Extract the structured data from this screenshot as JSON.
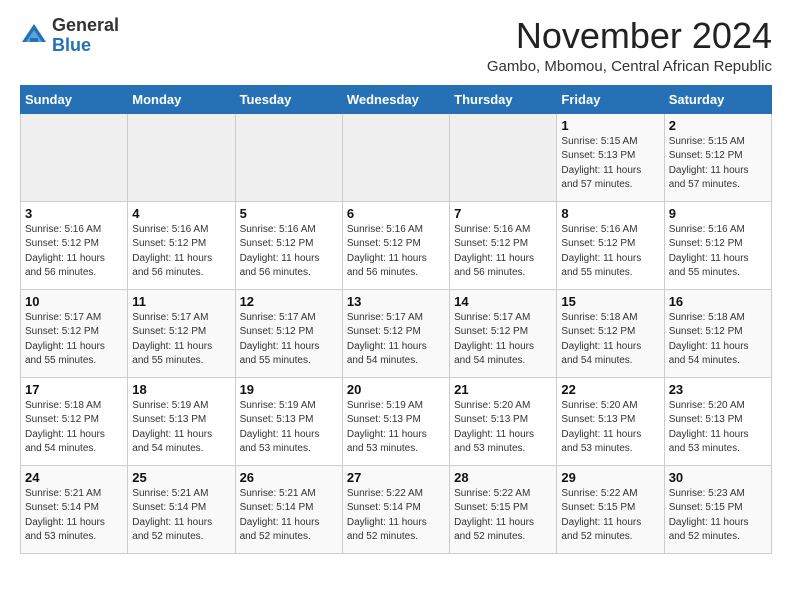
{
  "logo": {
    "general": "General",
    "blue": "Blue"
  },
  "header": {
    "month": "November 2024",
    "location": "Gambo, Mbomou, Central African Republic"
  },
  "weekdays": [
    "Sunday",
    "Monday",
    "Tuesday",
    "Wednesday",
    "Thursday",
    "Friday",
    "Saturday"
  ],
  "weeks": [
    [
      {
        "day": "",
        "info": ""
      },
      {
        "day": "",
        "info": ""
      },
      {
        "day": "",
        "info": ""
      },
      {
        "day": "",
        "info": ""
      },
      {
        "day": "",
        "info": ""
      },
      {
        "day": "1",
        "info": "Sunrise: 5:15 AM\nSunset: 5:13 PM\nDaylight: 11 hours\nand 57 minutes."
      },
      {
        "day": "2",
        "info": "Sunrise: 5:15 AM\nSunset: 5:12 PM\nDaylight: 11 hours\nand 57 minutes."
      }
    ],
    [
      {
        "day": "3",
        "info": "Sunrise: 5:16 AM\nSunset: 5:12 PM\nDaylight: 11 hours\nand 56 minutes."
      },
      {
        "day": "4",
        "info": "Sunrise: 5:16 AM\nSunset: 5:12 PM\nDaylight: 11 hours\nand 56 minutes."
      },
      {
        "day": "5",
        "info": "Sunrise: 5:16 AM\nSunset: 5:12 PM\nDaylight: 11 hours\nand 56 minutes."
      },
      {
        "day": "6",
        "info": "Sunrise: 5:16 AM\nSunset: 5:12 PM\nDaylight: 11 hours\nand 56 minutes."
      },
      {
        "day": "7",
        "info": "Sunrise: 5:16 AM\nSunset: 5:12 PM\nDaylight: 11 hours\nand 56 minutes."
      },
      {
        "day": "8",
        "info": "Sunrise: 5:16 AM\nSunset: 5:12 PM\nDaylight: 11 hours\nand 55 minutes."
      },
      {
        "day": "9",
        "info": "Sunrise: 5:16 AM\nSunset: 5:12 PM\nDaylight: 11 hours\nand 55 minutes."
      }
    ],
    [
      {
        "day": "10",
        "info": "Sunrise: 5:17 AM\nSunset: 5:12 PM\nDaylight: 11 hours\nand 55 minutes."
      },
      {
        "day": "11",
        "info": "Sunrise: 5:17 AM\nSunset: 5:12 PM\nDaylight: 11 hours\nand 55 minutes."
      },
      {
        "day": "12",
        "info": "Sunrise: 5:17 AM\nSunset: 5:12 PM\nDaylight: 11 hours\nand 55 minutes."
      },
      {
        "day": "13",
        "info": "Sunrise: 5:17 AM\nSunset: 5:12 PM\nDaylight: 11 hours\nand 54 minutes."
      },
      {
        "day": "14",
        "info": "Sunrise: 5:17 AM\nSunset: 5:12 PM\nDaylight: 11 hours\nand 54 minutes."
      },
      {
        "day": "15",
        "info": "Sunrise: 5:18 AM\nSunset: 5:12 PM\nDaylight: 11 hours\nand 54 minutes."
      },
      {
        "day": "16",
        "info": "Sunrise: 5:18 AM\nSunset: 5:12 PM\nDaylight: 11 hours\nand 54 minutes."
      }
    ],
    [
      {
        "day": "17",
        "info": "Sunrise: 5:18 AM\nSunset: 5:12 PM\nDaylight: 11 hours\nand 54 minutes."
      },
      {
        "day": "18",
        "info": "Sunrise: 5:19 AM\nSunset: 5:13 PM\nDaylight: 11 hours\nand 54 minutes."
      },
      {
        "day": "19",
        "info": "Sunrise: 5:19 AM\nSunset: 5:13 PM\nDaylight: 11 hours\nand 53 minutes."
      },
      {
        "day": "20",
        "info": "Sunrise: 5:19 AM\nSunset: 5:13 PM\nDaylight: 11 hours\nand 53 minutes."
      },
      {
        "day": "21",
        "info": "Sunrise: 5:20 AM\nSunset: 5:13 PM\nDaylight: 11 hours\nand 53 minutes."
      },
      {
        "day": "22",
        "info": "Sunrise: 5:20 AM\nSunset: 5:13 PM\nDaylight: 11 hours\nand 53 minutes."
      },
      {
        "day": "23",
        "info": "Sunrise: 5:20 AM\nSunset: 5:13 PM\nDaylight: 11 hours\nand 53 minutes."
      }
    ],
    [
      {
        "day": "24",
        "info": "Sunrise: 5:21 AM\nSunset: 5:14 PM\nDaylight: 11 hours\nand 53 minutes."
      },
      {
        "day": "25",
        "info": "Sunrise: 5:21 AM\nSunset: 5:14 PM\nDaylight: 11 hours\nand 52 minutes."
      },
      {
        "day": "26",
        "info": "Sunrise: 5:21 AM\nSunset: 5:14 PM\nDaylight: 11 hours\nand 52 minutes."
      },
      {
        "day": "27",
        "info": "Sunrise: 5:22 AM\nSunset: 5:14 PM\nDaylight: 11 hours\nand 52 minutes."
      },
      {
        "day": "28",
        "info": "Sunrise: 5:22 AM\nSunset: 5:15 PM\nDaylight: 11 hours\nand 52 minutes."
      },
      {
        "day": "29",
        "info": "Sunrise: 5:22 AM\nSunset: 5:15 PM\nDaylight: 11 hours\nand 52 minutes."
      },
      {
        "day": "30",
        "info": "Sunrise: 5:23 AM\nSunset: 5:15 PM\nDaylight: 11 hours\nand 52 minutes."
      }
    ]
  ]
}
